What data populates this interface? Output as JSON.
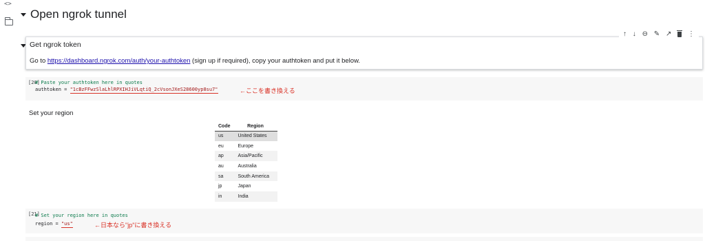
{
  "sidebar": {
    "code_toggle": "<>",
    "folder_icon": "folder-icon"
  },
  "section": {
    "title": "Open ngrok tunnel"
  },
  "toolbar": {
    "icons": [
      "arrow-up-icon",
      "arrow-down-icon",
      "link-icon",
      "edit-icon",
      "open-external-icon",
      "trash-icon",
      "more-icon"
    ],
    "glyphs": {
      "up": "↑",
      "down": "↓",
      "link": "⊖",
      "edit": "✎",
      "external": "↗",
      "more": "⋮"
    }
  },
  "text_cell": {
    "heading": "Get ngrok token",
    "instruction_prefix": "Go to ",
    "link": "https://dashboard.ngrok.com/auth/your-authtoken",
    "instruction_suffix": " (sign up if required), copy your authtoken and put it below."
  },
  "code_cell_1": {
    "exec_count": "[20]",
    "comment": "# Paste your authtoken here in quotes",
    "var": "authtoken = ",
    "value": "\"1cBzFFwzSlaLhlRPXIHJiVLqtiQ_2cVsonJXeS28600yp8su7\"",
    "annotation": "←ここを書き換える"
  },
  "region_heading": "Set your region",
  "region_table": {
    "headers": [
      "Code",
      "Region"
    ],
    "rows": [
      {
        "code": "us",
        "region": "United States"
      },
      {
        "code": "eu",
        "region": "Europe"
      },
      {
        "code": "ap",
        "region": "Asia/Pacific"
      },
      {
        "code": "au",
        "region": "Australia"
      },
      {
        "code": "sa",
        "region": "South America"
      },
      {
        "code": "jp",
        "region": "Japan"
      },
      {
        "code": "in",
        "region": "India"
      }
    ]
  },
  "code_cell_2": {
    "exec_count": "[21]",
    "comment": "# Set your region here in quotes",
    "var": "region = ",
    "value": "\"us\"",
    "annotation": "←日本なら\"jp\"に書き換える"
  },
  "colors": {
    "annotation": "#d93025",
    "link": "#1a0dab",
    "comment": "#0b7a4b",
    "string": "#a31515"
  }
}
